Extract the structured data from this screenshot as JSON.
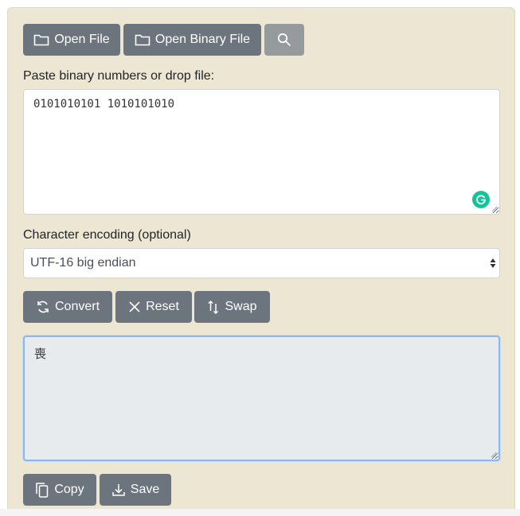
{
  "toolbar": {
    "open_file_label": "Open File",
    "open_binary_file_label": "Open Binary File",
    "search_icon": "search-icon"
  },
  "input": {
    "label": "Paste binary numbers or drop file:",
    "value": "0101010101 1010101010",
    "grammarly_icon": "grammarly-icon"
  },
  "encoding": {
    "label": "Character encoding (optional)",
    "selected": "UTF-16 big endian"
  },
  "actions": {
    "convert_label": "Convert",
    "reset_label": "Reset",
    "swap_label": "Swap"
  },
  "output": {
    "value": "喪"
  },
  "output_actions": {
    "copy_label": "Copy",
    "save_label": "Save"
  },
  "colors": {
    "panel_bg": "#ede6d3",
    "button_bg": "#6c757d",
    "button_disabled_bg": "#959a9d",
    "output_bg": "#e8ebee",
    "output_focus_border": "#8fb8e6",
    "grammarly": "#15c39a"
  }
}
